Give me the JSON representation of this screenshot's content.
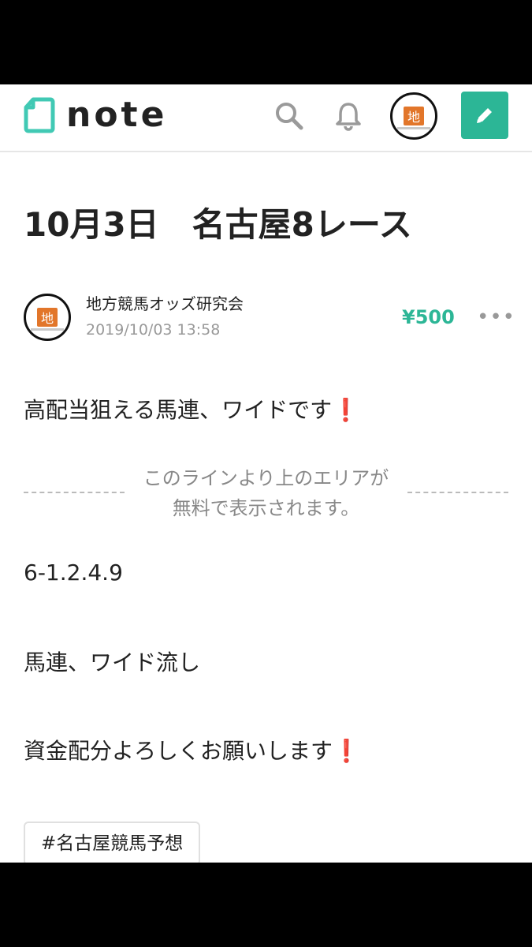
{
  "app": {
    "logo_text": "note",
    "icons": [
      "search-icon",
      "bell-icon",
      "pencil-icon"
    ],
    "accent_color": "#2cb696"
  },
  "avatar": {
    "glyph": "地",
    "caption": "地方競馬オッズ研究会"
  },
  "article": {
    "title": "10月3日　名古屋8レース",
    "author": "地方競馬オッズ研究会",
    "date": "2019/10/03 13:58",
    "price": "¥500",
    "more": "•••",
    "paragraph1": "高配当狙える馬連、ワイドです",
    "paywall_line1": "このラインより上のエリアが",
    "paywall_line2": "無料で表示されます。",
    "paragraph2": "6-1.2.4.9",
    "paragraph3": "馬連、ワイド流し",
    "paragraph4": "資金配分よろしくお願いします",
    "exclamation": "❗",
    "tag": "#名古屋競馬予想"
  }
}
